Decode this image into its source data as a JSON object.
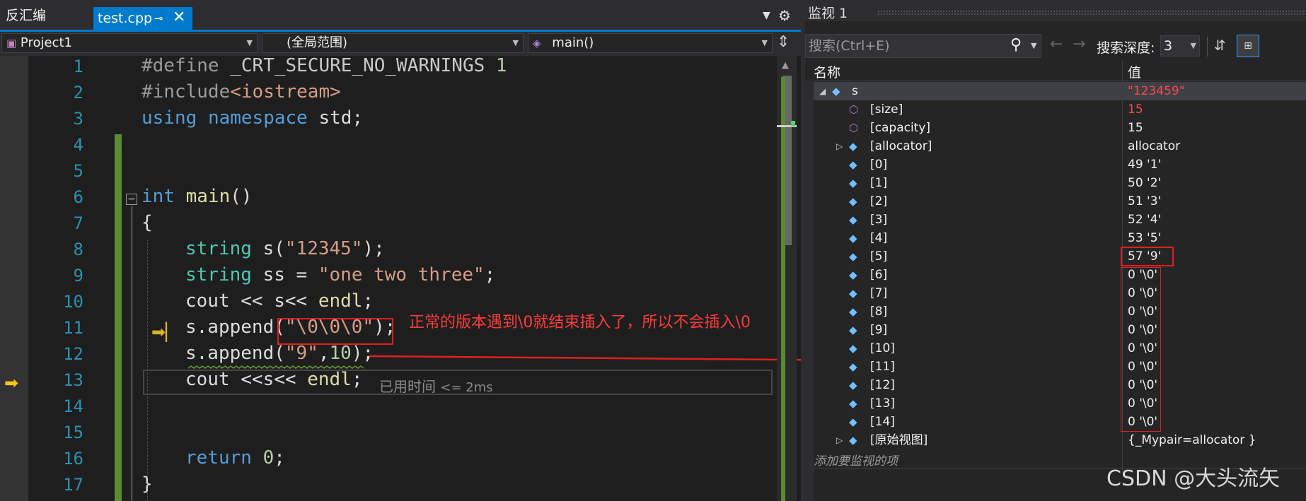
{
  "editor_tabs": {
    "disasm_label": "反汇编",
    "active_file": "test.cpp",
    "pin_glyph": "⊸",
    "close_glyph": "✕"
  },
  "navbar": {
    "project": "Project1",
    "scope": "(全局范围)",
    "function": "main()"
  },
  "line_numbers": [
    "1",
    "2",
    "3",
    "4",
    "5",
    "6",
    "7",
    "8",
    "9",
    "10",
    "11",
    "12",
    "13",
    "14",
    "15",
    "16",
    "17"
  ],
  "code": {
    "l1_directive": "#define",
    "l1_macro": "_CRT_SECURE_NO_WARNINGS",
    "l1_value": "1",
    "l2_directive": "#include",
    "l2_header": "<iostream>",
    "l3_using": "using",
    "l3_namespace": "namespace",
    "l3_rest": "std;",
    "l6_int": "int",
    "l6_main": "main",
    "l6_parens": "()",
    "l7_brace": "{",
    "l8_type": "string",
    "l8_decl": "s(",
    "l8_str": "\"12345\"",
    "l8_end": ");",
    "l9_type": "string",
    "l9_decl": "ss =",
    "l9_str": "\"one two three\"",
    "l9_end": ";",
    "l10_text": "cout << s<<",
    "l10_endl": "endl",
    "l10_end": ";",
    "l11_call": "s.append(",
    "l11_str": "\"\\0\\0\\0\"",
    "l11_end": ");",
    "l12_call": "s.append(",
    "l12_str": "\"9\"",
    "l12_comma": ",",
    "l12_num": "10",
    "l12_end": ");",
    "l13_text": "cout <<s<<",
    "l13_endl": "endl",
    "l13_end": ";",
    "l16_return": "return",
    "l16_num": "0",
    "l16_end": ";",
    "l17_brace": "}"
  },
  "perf_tip": {
    "label": "已用时间",
    "value": "<= 2ms"
  },
  "annotation": "正常的版本遇到\\0就结束插入了，所以不会插入\\0",
  "watch": {
    "title": "监视 1",
    "search_placeholder": "搜索(Ctrl+E)",
    "depth_label": "搜索深度:",
    "depth_value": "3",
    "col_name": "名称",
    "col_value": "值",
    "add_item": "添加要监视的项",
    "rows": [
      {
        "name": "s",
        "value": "\"123459\"",
        "changed": true
      },
      {
        "name": "[size]",
        "value": "15",
        "changed": true
      },
      {
        "name": "[capacity]",
        "value": "15",
        "changed": false
      },
      {
        "name": "[allocator]",
        "value": "allocator",
        "changed": false
      },
      {
        "name": "[0]",
        "value": "49 '1'",
        "changed": false
      },
      {
        "name": "[1]",
        "value": "50 '2'",
        "changed": false
      },
      {
        "name": "[2]",
        "value": "51 '3'",
        "changed": false
      },
      {
        "name": "[3]",
        "value": "52 '4'",
        "changed": false
      },
      {
        "name": "[4]",
        "value": "53 '5'",
        "changed": false
      },
      {
        "name": "[5]",
        "value": "57 '9'",
        "changed": false
      },
      {
        "name": "[6]",
        "value": "0 '\\0'",
        "changed": false
      },
      {
        "name": "[7]",
        "value": "0 '\\0'",
        "changed": false
      },
      {
        "name": "[8]",
        "value": "0 '\\0'",
        "changed": false
      },
      {
        "name": "[9]",
        "value": "0 '\\0'",
        "changed": false
      },
      {
        "name": "[10]",
        "value": "0 '\\0'",
        "changed": false
      },
      {
        "name": "[11]",
        "value": "0 '\\0'",
        "changed": false
      },
      {
        "name": "[12]",
        "value": "0 '\\0'",
        "changed": false
      },
      {
        "name": "[13]",
        "value": "0 '\\0'",
        "changed": false
      },
      {
        "name": "[14]",
        "value": "0 '\\0'",
        "changed": false
      },
      {
        "name": "[原始视图]",
        "value": "{_Mypair=allocator }",
        "changed": false
      }
    ]
  },
  "watermark": "CSDN @大头流矢"
}
